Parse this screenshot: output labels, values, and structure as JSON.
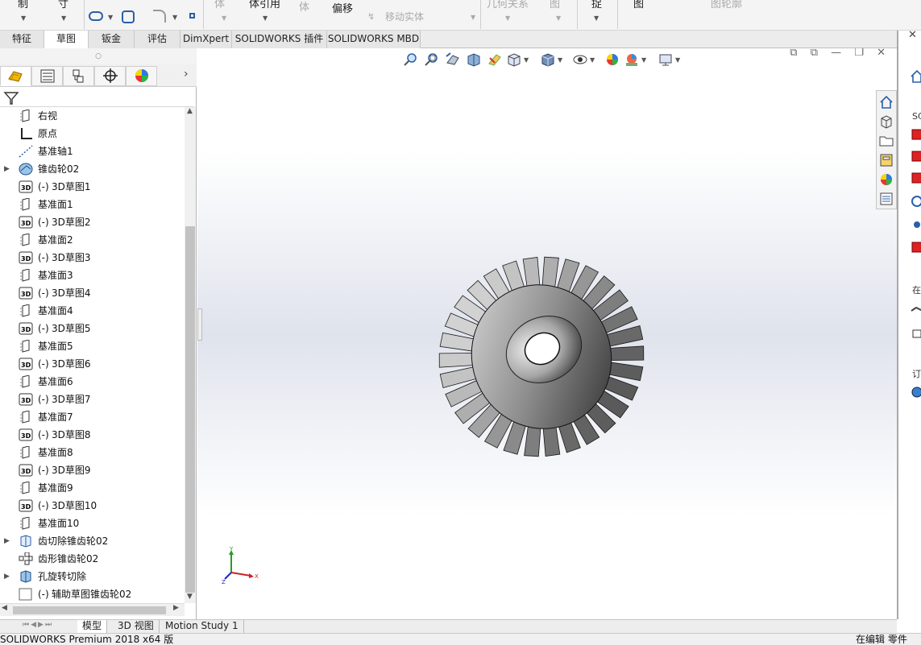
{
  "ribbon": {
    "labels": [
      {
        "id": "copy",
        "text": "制"
      },
      {
        "id": "import",
        "text": "寸"
      },
      {
        "id": "solid",
        "text": "体"
      },
      {
        "id": "solid2",
        "text": "体"
      },
      {
        "id": "ref",
        "text": "体引用"
      },
      {
        "id": "offset",
        "text": "偏移"
      },
      {
        "id": "move",
        "text": "移动实体"
      },
      {
        "id": "relations",
        "text": "几何关系"
      },
      {
        "id": "img",
        "text": "图"
      },
      {
        "id": "fix",
        "text": "复"
      },
      {
        "id": "quick",
        "text": "捉"
      },
      {
        "id": "view",
        "text": "图"
      },
      {
        "id": "contour",
        "text": "图轮廓"
      }
    ]
  },
  "command_tabs": [
    "特征",
    "草图",
    "钣金",
    "评估",
    "DimXpert",
    "SOLIDWORKS 插件",
    "SOLIDWORKS MBD"
  ],
  "active_command_tab": "草图",
  "left_panel": {
    "grip": "○",
    "tab_icons": [
      "featuremanager-icon",
      "propertymanager-icon",
      "configurationmanager-icon",
      "dimxpert-icon",
      "display-manager-icon"
    ],
    "more": "›",
    "tree": [
      {
        "icon": "plane-icon",
        "prefix": "",
        "label": "右视",
        "expand": ""
      },
      {
        "icon": "origin-icon",
        "prefix": "",
        "label": "原点",
        "expand": ""
      },
      {
        "icon": "axis-icon",
        "prefix": "",
        "label": "基准轴1",
        "expand": ""
      },
      {
        "icon": "part-icon",
        "prefix": "",
        "label": "锥齿轮02",
        "expand": "▶"
      },
      {
        "icon": "sketch3d-icon",
        "prefix": "(-)",
        "label": "3D草图1",
        "expand": ""
      },
      {
        "icon": "plane-icon",
        "prefix": "",
        "label": "基准面1",
        "expand": ""
      },
      {
        "icon": "sketch3d-icon",
        "prefix": "(-)",
        "label": "3D草图2",
        "expand": ""
      },
      {
        "icon": "plane-icon",
        "prefix": "",
        "label": "基准面2",
        "expand": ""
      },
      {
        "icon": "sketch3d-icon",
        "prefix": "(-)",
        "label": "3D草图3",
        "expand": ""
      },
      {
        "icon": "plane-icon",
        "prefix": "",
        "label": "基准面3",
        "expand": ""
      },
      {
        "icon": "sketch3d-icon",
        "prefix": "(-)",
        "label": "3D草图4",
        "expand": ""
      },
      {
        "icon": "plane-icon",
        "prefix": "",
        "label": "基准面4",
        "expand": ""
      },
      {
        "icon": "sketch3d-icon",
        "prefix": "(-)",
        "label": "3D草图5",
        "expand": ""
      },
      {
        "icon": "plane-icon",
        "prefix": "",
        "label": "基准面5",
        "expand": ""
      },
      {
        "icon": "sketch3d-icon",
        "prefix": "(-)",
        "label": "3D草图6",
        "expand": ""
      },
      {
        "icon": "plane-icon",
        "prefix": "",
        "label": "基准面6",
        "expand": ""
      },
      {
        "icon": "sketch3d-icon",
        "prefix": "(-)",
        "label": "3D草图7",
        "expand": ""
      },
      {
        "icon": "plane-icon",
        "prefix": "",
        "label": "基准面7",
        "expand": ""
      },
      {
        "icon": "sketch3d-icon",
        "prefix": "(-)",
        "label": "3D草图8",
        "expand": ""
      },
      {
        "icon": "plane-icon",
        "prefix": "",
        "label": "基准面8",
        "expand": ""
      },
      {
        "icon": "sketch3d-icon",
        "prefix": "(-)",
        "label": "3D草图9",
        "expand": ""
      },
      {
        "icon": "plane-icon",
        "prefix": "",
        "label": "基准面9",
        "expand": ""
      },
      {
        "icon": "sketch3d-icon",
        "prefix": "(-)",
        "label": "3D草图10",
        "expand": ""
      },
      {
        "icon": "plane-icon",
        "prefix": "",
        "label": "基准面10",
        "expand": ""
      },
      {
        "icon": "cut-icon",
        "prefix": "",
        "label": "齿切除锥齿轮02",
        "expand": "▶"
      },
      {
        "icon": "pattern-icon",
        "prefix": "",
        "label": "齿形锥齿轮02",
        "expand": ""
      },
      {
        "icon": "revolve-cut-icon",
        "prefix": "",
        "label": "孔旋转切除",
        "expand": "▶"
      },
      {
        "icon": "sketch-icon",
        "prefix": "(-)",
        "label": "辅助草图锥齿轮02",
        "expand": ""
      }
    ]
  },
  "viewport": {
    "window_controls": [
      "⧉",
      "⧉",
      "—",
      "❐",
      "✕"
    ],
    "heads_up_icons": [
      "zoom-to-fit-icon",
      "zoom-area-icon",
      "previous-view-icon",
      "section-view-icon",
      "dynamic-annotation-icon",
      "view-orientation-icon",
      "display-style-icon",
      "hide-show-icon",
      "edit-appearance-icon",
      "apply-scene-icon",
      "view-settings-icon"
    ],
    "triad": {
      "x": "X",
      "y": "Y",
      "z": "Z"
    }
  },
  "task_pane": {
    "labels": [
      "SC",
      "在",
      "订"
    ]
  },
  "bottom_tabs": [
    "模型",
    "3D 视图",
    "Motion Study 1"
  ],
  "active_bottom_tab": "模型",
  "status": {
    "left": "SOLIDWORKS Premium 2018 x64 版",
    "right": "在编辑 零件"
  },
  "colors": {
    "accent": "#1a64b4",
    "selection": "#cfe3f7"
  }
}
